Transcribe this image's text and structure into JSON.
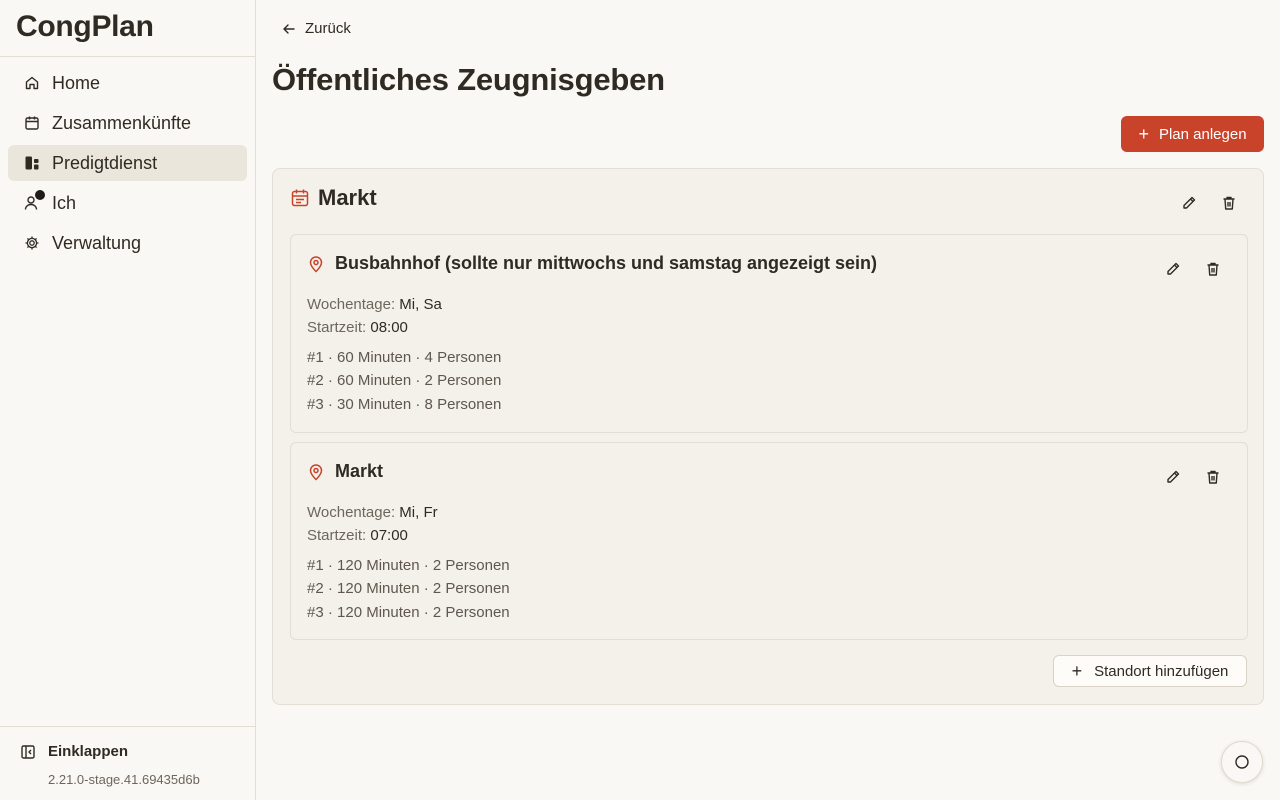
{
  "app": {
    "title": "CongPlan",
    "version": "2.21.0-stage.41.69435d6b"
  },
  "sidebar": {
    "items": [
      {
        "label": "Home",
        "icon": "home-icon"
      },
      {
        "label": "Zusammenkünfte",
        "icon": "calendar-icon"
      },
      {
        "label": "Predigtdienst",
        "icon": "preaching-icon",
        "active": true
      },
      {
        "label": "Ich",
        "icon": "user-icon",
        "badge": true
      },
      {
        "label": "Verwaltung",
        "icon": "gear-icon"
      }
    ],
    "collapse_label": "Einklappen"
  },
  "header": {
    "back_label": "Zurück",
    "title": "Öffentliches Zeugnisgeben",
    "add_plan_label": "Plan anlegen"
  },
  "plan": {
    "title": "Markt",
    "locations": [
      {
        "name": "Busbahnhof (sollte nur mittwochs und samstag angezeigt sein)",
        "weekdays_label": "Wochentage:",
        "weekdays": "Mi, Sa",
        "start_label": "Startzeit:",
        "start": "08:00",
        "shifts": [
          "#1 · 60 Minuten · 4 Personen",
          "#2 · 60 Minuten · 2 Personen",
          "#3 · 30 Minuten · 8 Personen"
        ]
      },
      {
        "name": "Markt",
        "weekdays_label": "Wochentage:",
        "weekdays": "Mi, Fr",
        "start_label": "Startzeit:",
        "start": "07:00",
        "shifts": [
          "#1 · 120 Minuten · 2 Personen",
          "#2 · 120 Minuten · 2 Personen",
          "#3 · 120 Minuten · 2 Personen"
        ]
      }
    ],
    "add_location_label": "Standort hinzufügen"
  },
  "colors": {
    "accent": "#c8432a",
    "background": "#faf8f4",
    "card": "#f4f1eb"
  }
}
